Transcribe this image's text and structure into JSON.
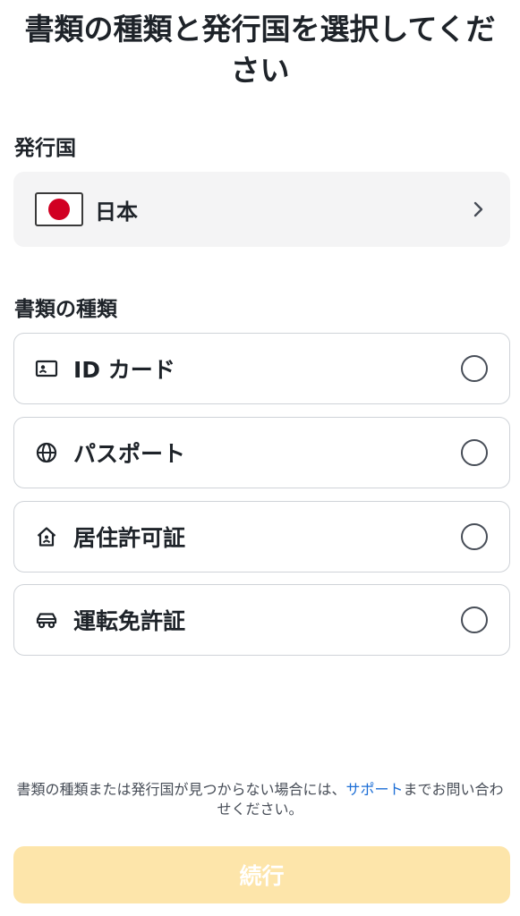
{
  "title": "書類の種類と発行国を選択してください",
  "country_section": {
    "label": "発行国",
    "selected_country": "日本",
    "flag_icon": "japan-flag-icon"
  },
  "document_section": {
    "label": "書類の種類",
    "options": [
      {
        "label": "ID カード",
        "icon": "id-card-icon",
        "selected": false
      },
      {
        "label": "パスポート",
        "icon": "globe-icon",
        "selected": false
      },
      {
        "label": "居住許可証",
        "icon": "house-icon",
        "selected": false
      },
      {
        "label": "運転免許証",
        "icon": "car-icon",
        "selected": false
      }
    ]
  },
  "help": {
    "text_before": "書類の種類または発行国が見つからない場合には、",
    "link": "サポート",
    "text_after": "までお問い合わせください。"
  },
  "continue_button": {
    "label": "続行",
    "enabled": false
  },
  "colors": {
    "text": "#1e2329",
    "link": "#1c6ed6",
    "button_disabled_bg": "#fde5aa",
    "flag_red": "#d10022",
    "select_bg": "#f4f4f5"
  }
}
